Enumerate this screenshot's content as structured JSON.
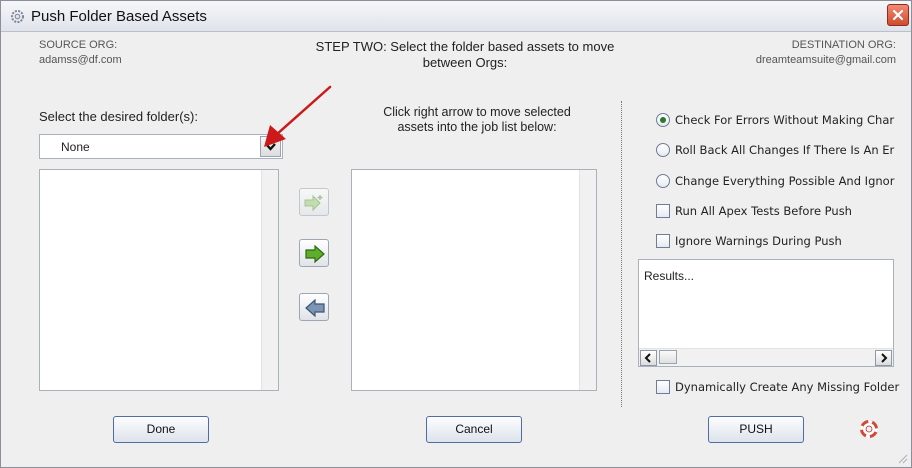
{
  "window": {
    "title": "Push Folder Based Assets"
  },
  "source": {
    "label": "SOURCE ORG:",
    "account": "adamss@df.com"
  },
  "destination": {
    "label": "DESTINATION ORG:",
    "account": "dreamteamsuite@gmail.com"
  },
  "step": {
    "line1": "STEP TWO: Select the folder based assets to move",
    "line2": "between Orgs:"
  },
  "folder_select": {
    "label": "Select the desired folder(s):",
    "selected": "None"
  },
  "middle": {
    "line1": "Click right arrow to move selected",
    "line2": "assets into the job list below:"
  },
  "options": {
    "radio1": "Check For Errors Without Making Char",
    "radio2": "Roll Back All Changes If There Is An Er",
    "radio3": "Change Everything Possible And Ignor",
    "check1": "Run All Apex Tests Before Push",
    "check2": "Ignore Warnings During Push",
    "check3": "Dynamically Create Any Missing Folder"
  },
  "results": {
    "text": "Results..."
  },
  "buttons": {
    "done": "Done",
    "cancel": "Cancel",
    "push": "PUSH"
  },
  "colors": {
    "accent_arrow": "#5fae2b",
    "annotation": "#cc1a1a",
    "button_border": "#4d6da4"
  }
}
